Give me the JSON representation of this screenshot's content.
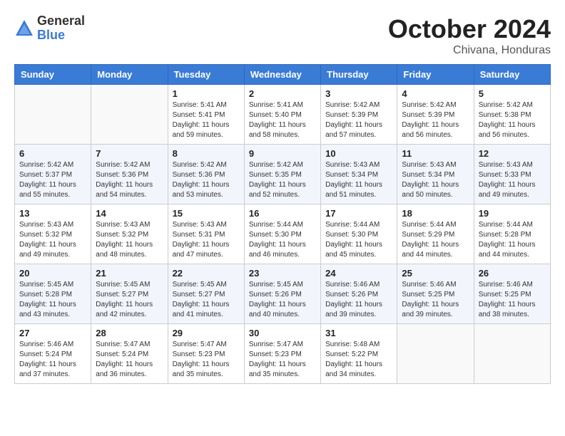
{
  "header": {
    "logo_general": "General",
    "logo_blue": "Blue",
    "month_title": "October 2024",
    "subtitle": "Chivana, Honduras"
  },
  "days_of_week": [
    "Sunday",
    "Monday",
    "Tuesday",
    "Wednesday",
    "Thursday",
    "Friday",
    "Saturday"
  ],
  "weeks": [
    [
      {
        "day": "",
        "info": ""
      },
      {
        "day": "",
        "info": ""
      },
      {
        "day": "1",
        "info": "Sunrise: 5:41 AM\nSunset: 5:41 PM\nDaylight: 11 hours and 59 minutes."
      },
      {
        "day": "2",
        "info": "Sunrise: 5:41 AM\nSunset: 5:40 PM\nDaylight: 11 hours and 58 minutes."
      },
      {
        "day": "3",
        "info": "Sunrise: 5:42 AM\nSunset: 5:39 PM\nDaylight: 11 hours and 57 minutes."
      },
      {
        "day": "4",
        "info": "Sunrise: 5:42 AM\nSunset: 5:39 PM\nDaylight: 11 hours and 56 minutes."
      },
      {
        "day": "5",
        "info": "Sunrise: 5:42 AM\nSunset: 5:38 PM\nDaylight: 11 hours and 56 minutes."
      }
    ],
    [
      {
        "day": "6",
        "info": "Sunrise: 5:42 AM\nSunset: 5:37 PM\nDaylight: 11 hours and 55 minutes."
      },
      {
        "day": "7",
        "info": "Sunrise: 5:42 AM\nSunset: 5:36 PM\nDaylight: 11 hours and 54 minutes."
      },
      {
        "day": "8",
        "info": "Sunrise: 5:42 AM\nSunset: 5:36 PM\nDaylight: 11 hours and 53 minutes."
      },
      {
        "day": "9",
        "info": "Sunrise: 5:42 AM\nSunset: 5:35 PM\nDaylight: 11 hours and 52 minutes."
      },
      {
        "day": "10",
        "info": "Sunrise: 5:43 AM\nSunset: 5:34 PM\nDaylight: 11 hours and 51 minutes."
      },
      {
        "day": "11",
        "info": "Sunrise: 5:43 AM\nSunset: 5:34 PM\nDaylight: 11 hours and 50 minutes."
      },
      {
        "day": "12",
        "info": "Sunrise: 5:43 AM\nSunset: 5:33 PM\nDaylight: 11 hours and 49 minutes."
      }
    ],
    [
      {
        "day": "13",
        "info": "Sunrise: 5:43 AM\nSunset: 5:32 PM\nDaylight: 11 hours and 49 minutes."
      },
      {
        "day": "14",
        "info": "Sunrise: 5:43 AM\nSunset: 5:32 PM\nDaylight: 11 hours and 48 minutes."
      },
      {
        "day": "15",
        "info": "Sunrise: 5:43 AM\nSunset: 5:31 PM\nDaylight: 11 hours and 47 minutes."
      },
      {
        "day": "16",
        "info": "Sunrise: 5:44 AM\nSunset: 5:30 PM\nDaylight: 11 hours and 46 minutes."
      },
      {
        "day": "17",
        "info": "Sunrise: 5:44 AM\nSunset: 5:30 PM\nDaylight: 11 hours and 45 minutes."
      },
      {
        "day": "18",
        "info": "Sunrise: 5:44 AM\nSunset: 5:29 PM\nDaylight: 11 hours and 44 minutes."
      },
      {
        "day": "19",
        "info": "Sunrise: 5:44 AM\nSunset: 5:28 PM\nDaylight: 11 hours and 44 minutes."
      }
    ],
    [
      {
        "day": "20",
        "info": "Sunrise: 5:45 AM\nSunset: 5:28 PM\nDaylight: 11 hours and 43 minutes."
      },
      {
        "day": "21",
        "info": "Sunrise: 5:45 AM\nSunset: 5:27 PM\nDaylight: 11 hours and 42 minutes."
      },
      {
        "day": "22",
        "info": "Sunrise: 5:45 AM\nSunset: 5:27 PM\nDaylight: 11 hours and 41 minutes."
      },
      {
        "day": "23",
        "info": "Sunrise: 5:45 AM\nSunset: 5:26 PM\nDaylight: 11 hours and 40 minutes."
      },
      {
        "day": "24",
        "info": "Sunrise: 5:46 AM\nSunset: 5:26 PM\nDaylight: 11 hours and 39 minutes."
      },
      {
        "day": "25",
        "info": "Sunrise: 5:46 AM\nSunset: 5:25 PM\nDaylight: 11 hours and 39 minutes."
      },
      {
        "day": "26",
        "info": "Sunrise: 5:46 AM\nSunset: 5:25 PM\nDaylight: 11 hours and 38 minutes."
      }
    ],
    [
      {
        "day": "27",
        "info": "Sunrise: 5:46 AM\nSunset: 5:24 PM\nDaylight: 11 hours and 37 minutes."
      },
      {
        "day": "28",
        "info": "Sunrise: 5:47 AM\nSunset: 5:24 PM\nDaylight: 11 hours and 36 minutes."
      },
      {
        "day": "29",
        "info": "Sunrise: 5:47 AM\nSunset: 5:23 PM\nDaylight: 11 hours and 35 minutes."
      },
      {
        "day": "30",
        "info": "Sunrise: 5:47 AM\nSunset: 5:23 PM\nDaylight: 11 hours and 35 minutes."
      },
      {
        "day": "31",
        "info": "Sunrise: 5:48 AM\nSunset: 5:22 PM\nDaylight: 11 hours and 34 minutes."
      },
      {
        "day": "",
        "info": ""
      },
      {
        "day": "",
        "info": ""
      }
    ]
  ]
}
